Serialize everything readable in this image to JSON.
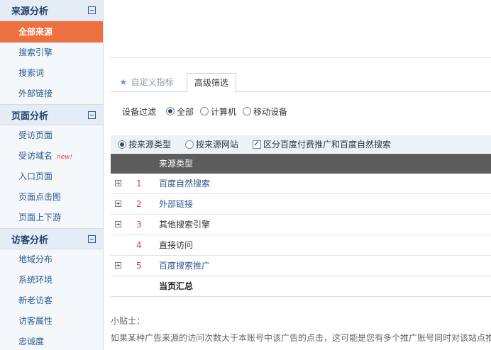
{
  "sidebar": {
    "sections": [
      {
        "title": "来源分析",
        "items": [
          {
            "label": "全部来源",
            "active": true
          },
          {
            "label": "搜索引擎"
          },
          {
            "label": "搜索词"
          },
          {
            "label": "外部链接"
          }
        ]
      },
      {
        "title": "页面分析",
        "items": [
          {
            "label": "受访页面"
          },
          {
            "label": "受访域名",
            "badge": "new!"
          },
          {
            "label": "入口页面"
          },
          {
            "label": "页面点击图"
          },
          {
            "label": "页面上下游"
          }
        ]
      },
      {
        "title": "访客分析",
        "items": [
          {
            "label": "地域分布"
          },
          {
            "label": "系统环境"
          },
          {
            "label": "新老访客"
          },
          {
            "label": "访客属性"
          },
          {
            "label": "忠诚度"
          }
        ]
      }
    ]
  },
  "tabs": {
    "custom": "自定义指标",
    "advanced": "高级筛选"
  },
  "device_filter": {
    "label": "设备过滤",
    "options": [
      "全部",
      "计算机",
      "移动设备"
    ],
    "selected": "全部"
  },
  "source_mode": {
    "by_type": "按来源类型",
    "by_site": "按来源网站",
    "selected": "按来源类型",
    "distinguish_label": "区分百度付费推广和百度自然搜索",
    "distinguish_checked": true
  },
  "table": {
    "header": "来源类型",
    "rows": [
      {
        "index": "1",
        "name": "百度自然搜索",
        "link": true,
        "expandable": true
      },
      {
        "index": "2",
        "name": "外部链接",
        "link": true,
        "expandable": true
      },
      {
        "index": "3",
        "name": "其他搜索引擎",
        "link": false,
        "expandable": true
      },
      {
        "index": "4",
        "name": "直接访问",
        "link": false,
        "expandable": false
      },
      {
        "index": "5",
        "name": "百度搜索推广",
        "link": true,
        "expandable": true
      }
    ],
    "total_label": "当页汇总"
  },
  "tips": {
    "title": "小贴士：",
    "text": "如果某种广告来源的访问次数大于本账号中该广告的点击，这可能是您有多个推广账号同时对该站点推"
  }
}
